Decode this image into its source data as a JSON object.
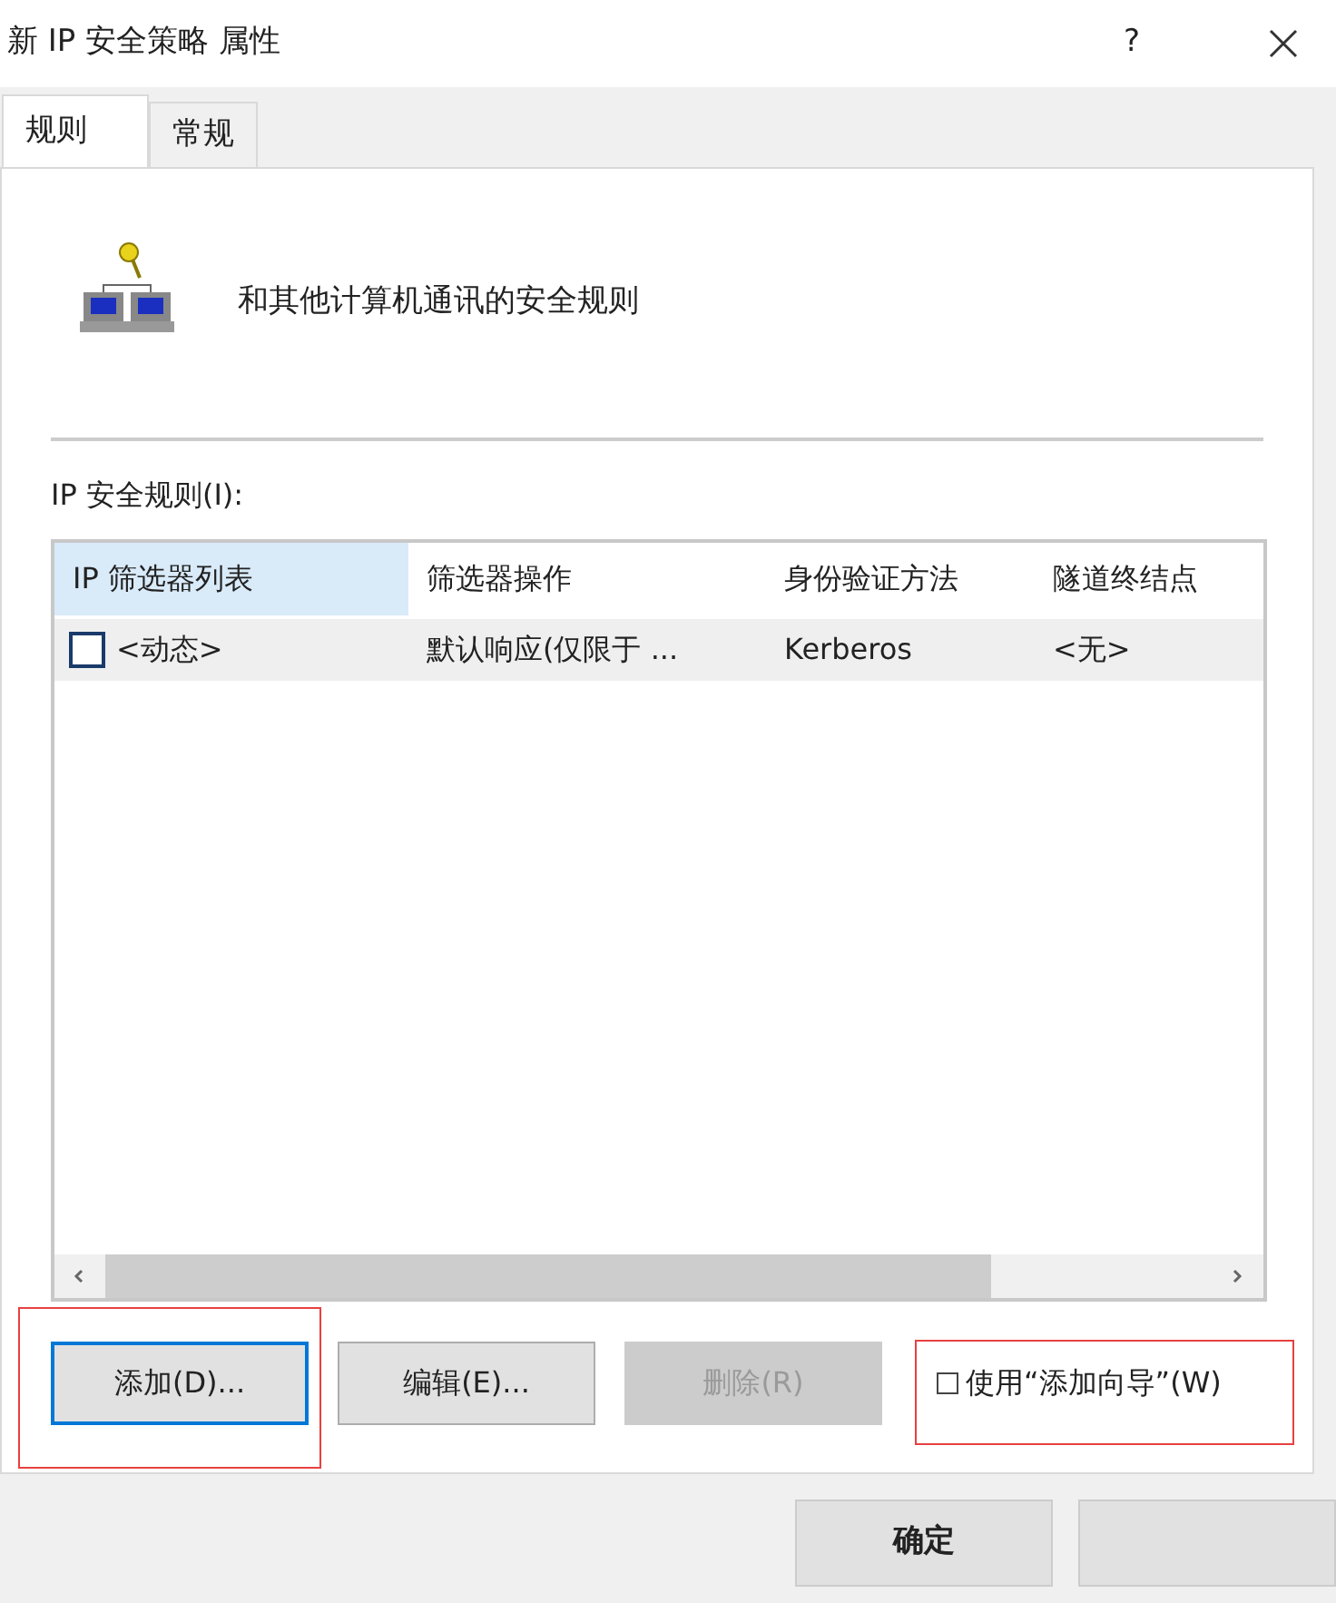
{
  "window": {
    "title": "新 IP 安全策略 属性",
    "help": "?"
  },
  "tabs": [
    {
      "label": "规则",
      "selected": true
    },
    {
      "label": "常规",
      "selected": false
    }
  ],
  "description": "和其他计算机通讯的安全规则",
  "rules_label": "IP 安全规则(I):",
  "table": {
    "columns": [
      {
        "label": "IP 筛选器列表",
        "selected": true
      },
      {
        "label": "筛选器操作",
        "selected": false
      },
      {
        "label": "身份验证方法",
        "selected": false
      },
      {
        "label": "隧道终结点",
        "selected": false
      }
    ],
    "rows": [
      {
        "checked": false,
        "selected": true,
        "cells": [
          "<动态>",
          "默认响应(仅限于 ...",
          "Kerberos",
          "<无>"
        ]
      }
    ]
  },
  "buttons": [
    {
      "label": "添加(D)...",
      "disabled": false,
      "focused": true,
      "highlighted": true
    },
    {
      "label": "编辑(E)...",
      "disabled": false,
      "focused": false,
      "highlighted": false
    },
    {
      "label": "删除(R)",
      "disabled": true,
      "focused": false,
      "highlighted": false
    }
  ],
  "wizard": {
    "label": "使用“添加向导”(W)",
    "checked": false,
    "highlighted": true
  },
  "dialog_buttons": [
    {
      "kind": "labeled",
      "label": "确定"
    },
    {
      "kind": "unlabeled"
    }
  ]
}
